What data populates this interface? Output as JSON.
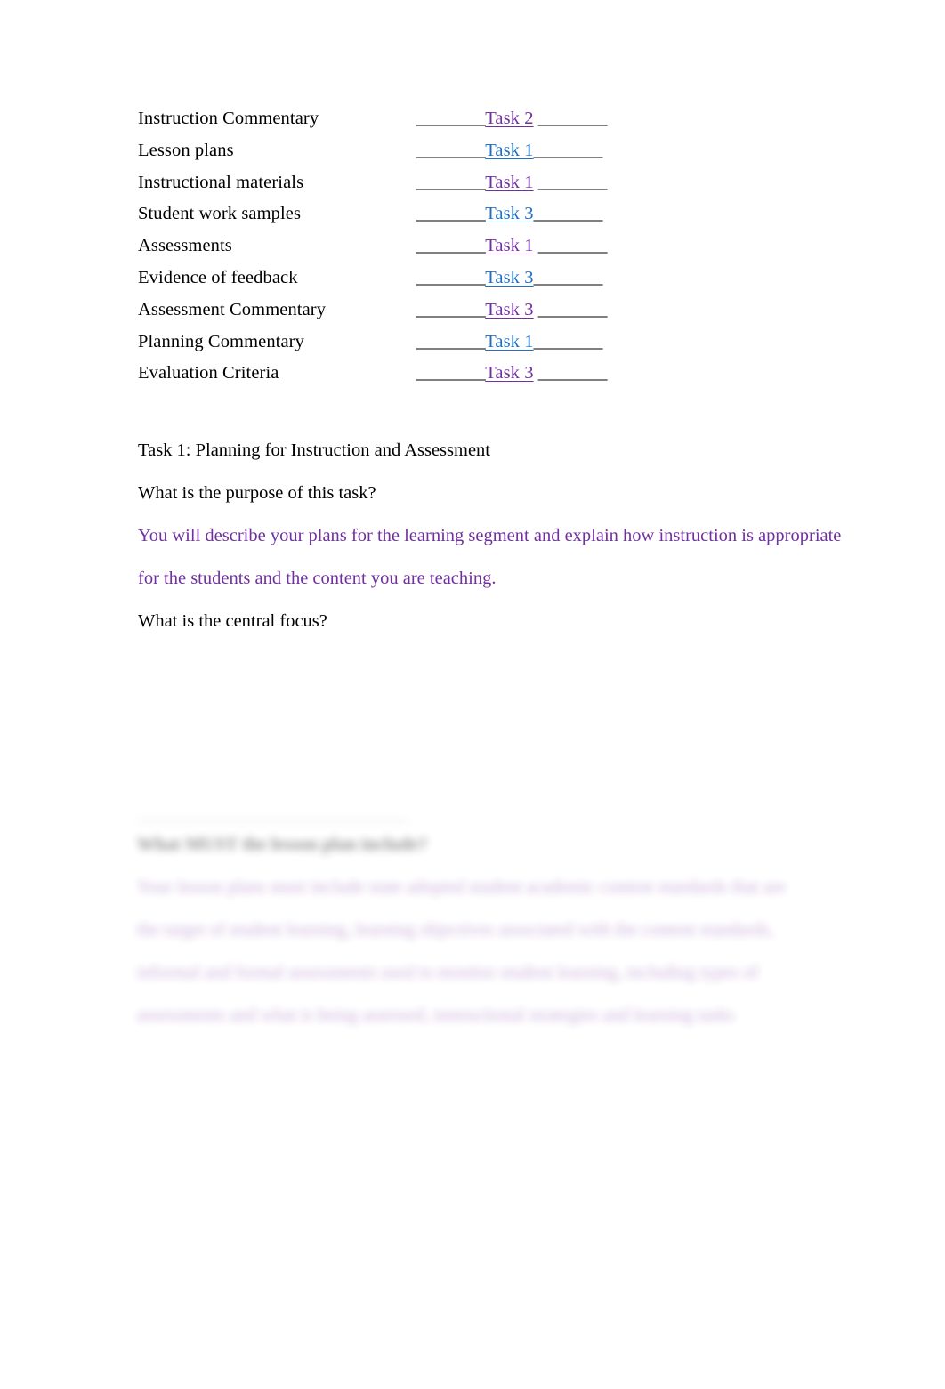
{
  "document": {
    "page_background": "#ffffff",
    "text_color": "#000000",
    "link_visited_color": "#7030A0",
    "link_unvisited_color": "#1F6FC4"
  },
  "index_list": {
    "leading_rule": "________",
    "trailing_rule": "________",
    "rows": [
      {
        "label": "Instruction Commentary",
        "link": "Task 2",
        "state": "visited",
        "gap_before_trailing": " "
      },
      {
        "label": "Lesson plans",
        "link": "Task 1",
        "state": "unvisited",
        "gap_before_trailing": ""
      },
      {
        "label": "Instructional materials",
        "link": "Task 1",
        "state": "visited",
        "gap_before_trailing": " "
      },
      {
        "label": "Student work samples",
        "link": "Task 3",
        "state": "unvisited",
        "gap_before_trailing": ""
      },
      {
        "label": "Assessments",
        "link": "Task 1",
        "state": "visited",
        "gap_before_trailing": " "
      },
      {
        "label": "Evidence of feedback",
        "link": "Task 3",
        "state": "unvisited",
        "gap_before_trailing": ""
      },
      {
        "label": "Assessment Commentary",
        "link": "Task 3",
        "state": "visited",
        "gap_before_trailing": " "
      },
      {
        "label": "Planning Commentary",
        "link": "Task 1",
        "state": "unvisited",
        "gap_before_trailing": ""
      },
      {
        "label": "Evaluation Criteria",
        "link": "Task 3",
        "state": "visited",
        "gap_before_trailing": " "
      }
    ]
  },
  "task_section": {
    "heading": "Task 1: Planning for Instruction and Assessment",
    "purpose_question": "What is the purpose of this task?",
    "purpose_answer": "You will describe your plans for the learning segment and explain how instruction is appropriate for the students and the content you are teaching.",
    "central_focus_question": "What is the central focus?"
  },
  "blurred_region": {
    "note": "illegible / blurred content",
    "heading": "What MUST the lesson plan include?",
    "lines": [
      "Your lesson plans must include state adopted student academic content standards that are",
      "the target of student learning, learning objectives associated with the content standards,",
      "informal and formal assessments used to monitor student learning, including types of",
      "assessments and what is being assessed, instructional strategies and learning tasks"
    ]
  }
}
